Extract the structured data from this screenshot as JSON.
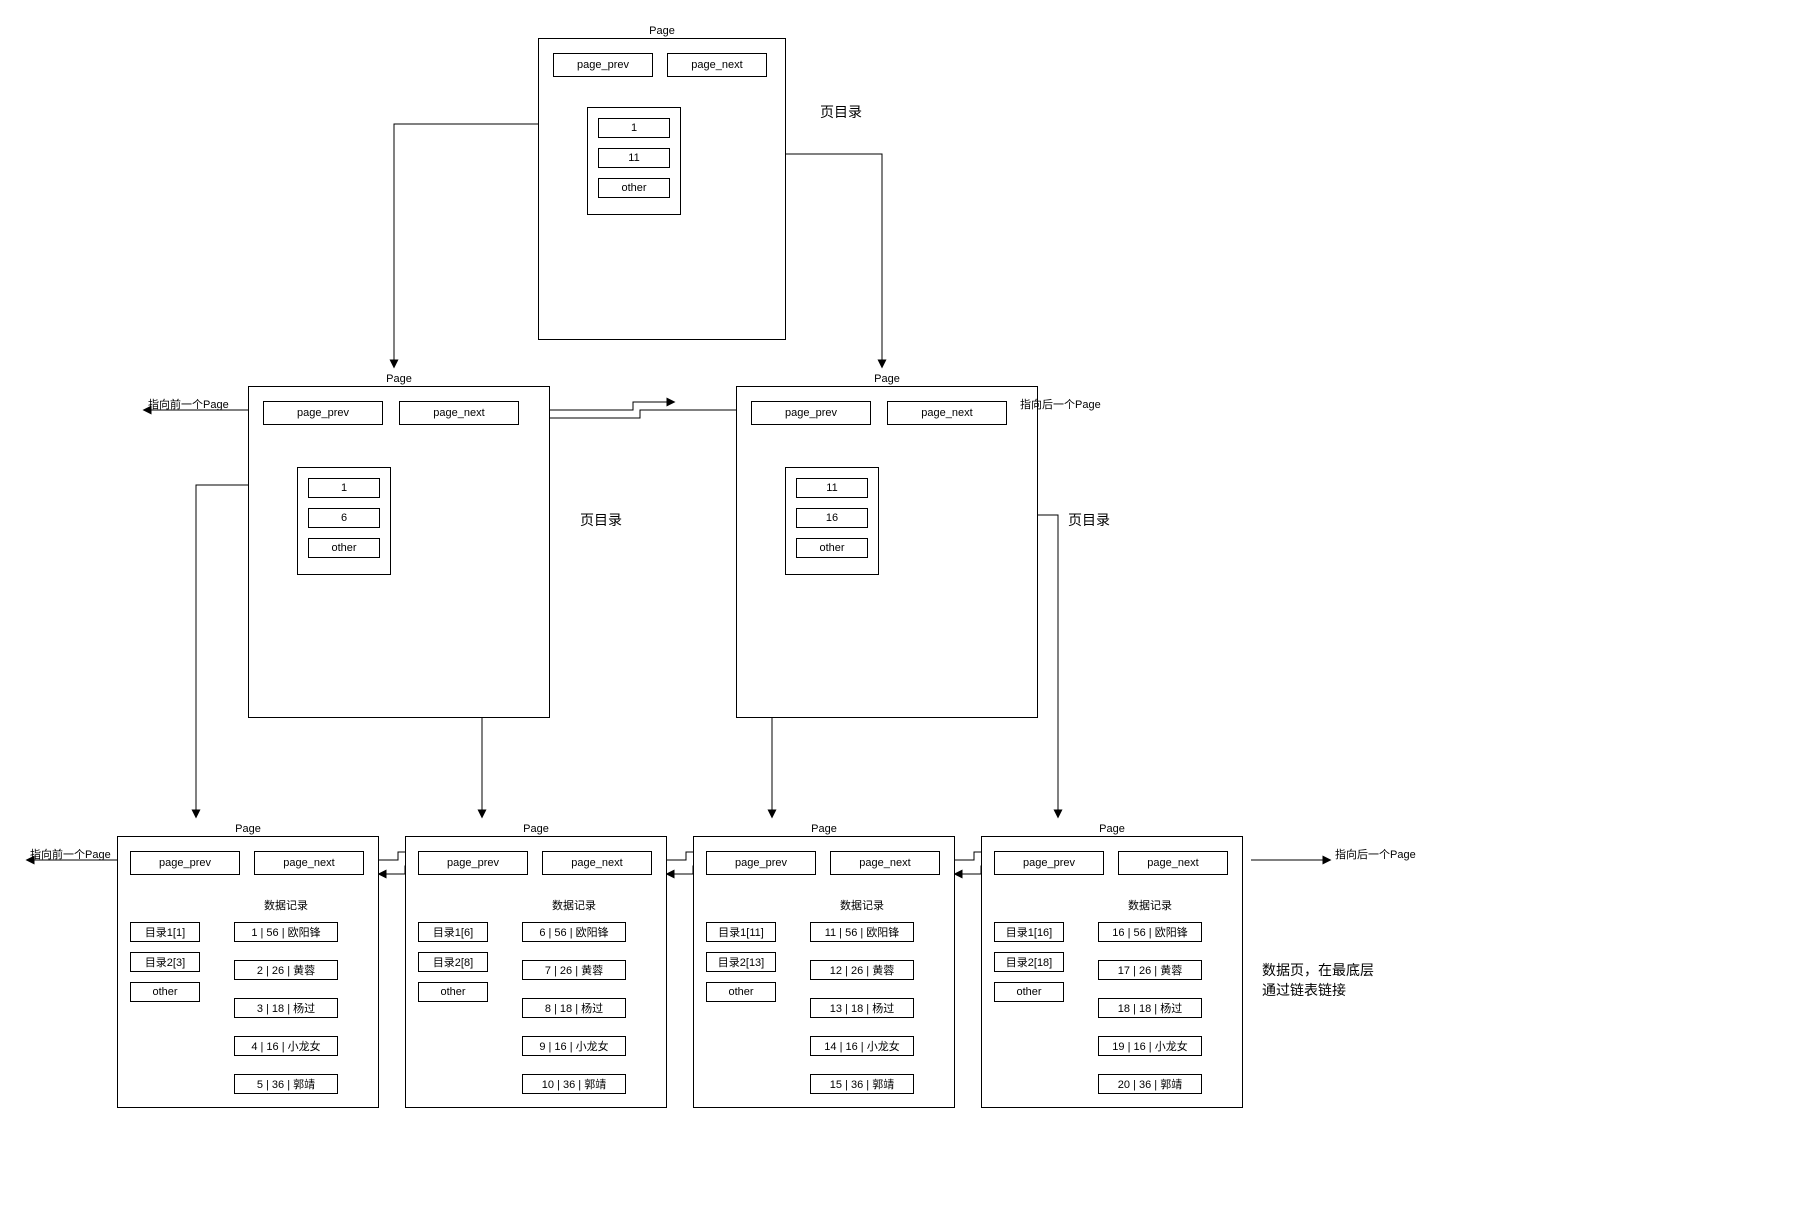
{
  "labels": {
    "page_title": "Page",
    "page_prev": "page_prev",
    "page_next": "page_next",
    "other": "other",
    "directory_label": "页目录",
    "data_record_label": "数据记录",
    "prev_page_arrow_label": "指向前一个Page",
    "next_page_arrow_label": "指向后一个Page",
    "description_line1": "数据页，在最底层",
    "description_line2": "通过链表链接"
  },
  "root_page": {
    "entries": [
      "1",
      "11",
      "other"
    ]
  },
  "mid_pages": [
    {
      "entries": [
        "1",
        "6",
        "other"
      ]
    },
    {
      "entries": [
        "11",
        "16",
        "other"
      ]
    }
  ],
  "leaf_pages": [
    {
      "dir_entries": [
        "目录1[1]",
        "目录2[3]",
        "other"
      ],
      "data_rows": [
        "1 | 56 | 欧阳锋",
        "2 | 26 | 黄蓉",
        "3 | 18 | 杨过",
        "4 | 16 | 小龙女",
        "5 | 36 | 郭靖"
      ]
    },
    {
      "dir_entries": [
        "目录1[6]",
        "目录2[8]",
        "other"
      ],
      "data_rows": [
        "6 | 56 | 欧阳锋",
        "7 | 26 | 黄蓉",
        "8 | 18 | 杨过",
        "9 | 16 | 小龙女",
        "10 | 36 | 郭靖"
      ]
    },
    {
      "dir_entries": [
        "目录1[11]",
        "目录2[13]",
        "other"
      ],
      "data_rows": [
        "11 | 56 | 欧阳锋",
        "12 | 26 | 黄蓉",
        "13 | 18 | 杨过",
        "14 | 16 | 小龙女",
        "15 | 36 | 郭靖"
      ]
    },
    {
      "dir_entries": [
        "目录1[16]",
        "目录2[18]",
        "other"
      ],
      "data_rows": [
        "16 | 56 | 欧阳锋",
        "17 | 26 | 黄蓉",
        "18 | 18 | 杨过",
        "19 | 16 | 小龙女",
        "20 | 36 | 郭靖"
      ]
    }
  ]
}
